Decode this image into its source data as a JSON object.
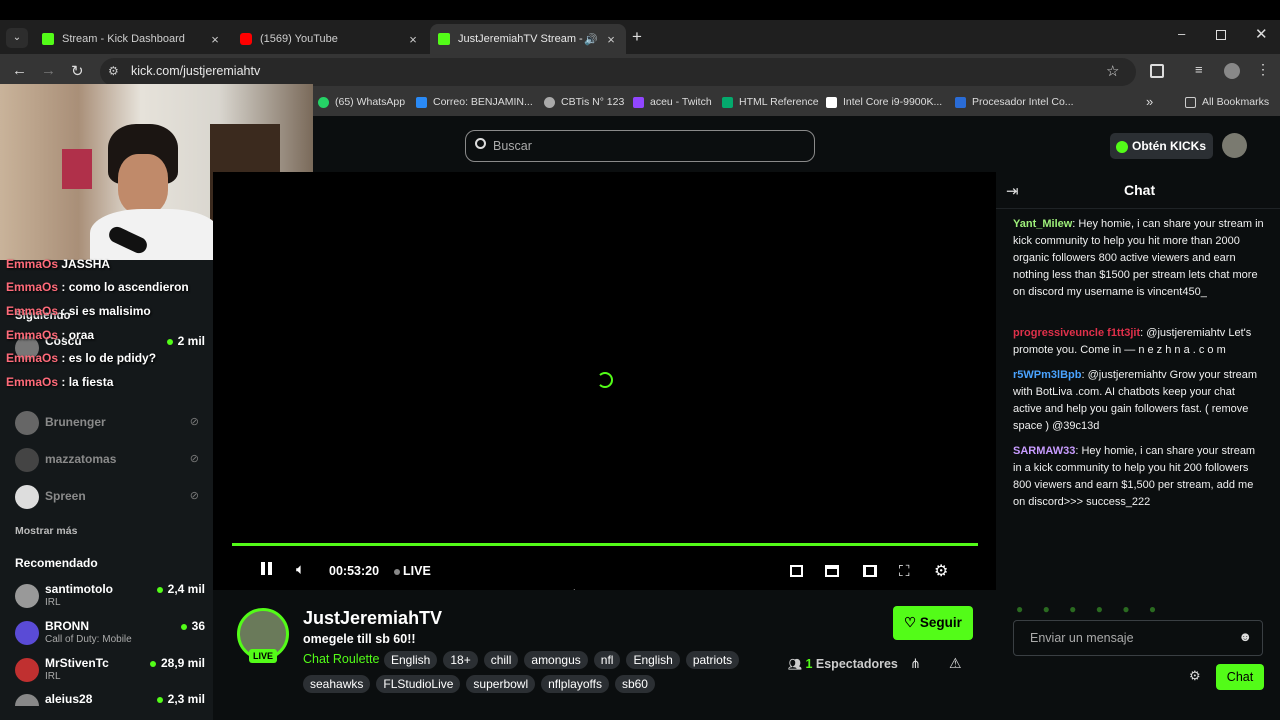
{
  "browser": {
    "tabs": [
      {
        "title": "Stream - Kick Dashboard",
        "icon": "kick-icon"
      },
      {
        "title": "(1569) YouTube",
        "icon": "youtube-icon"
      },
      {
        "title": "JustJeremiahTV Stream - W",
        "icon": "kick-icon"
      }
    ],
    "url": "kick.com/justjeremiahtv",
    "bookmarks": [
      "(65) WhatsApp",
      "Correo: BENJAMIN...",
      "CBTis N° 123",
      "aceu - Twitch",
      "HTML Reference",
      "Intel Core i9-9900K...",
      "Procesador Intel Co..."
    ],
    "all_bookmarks": "All Bookmarks",
    "overflow": "»"
  },
  "header": {
    "search_placeholder": "Buscar",
    "kicks_button": "Obtén KICKs"
  },
  "overlay_chat": [
    {
      "user": "EmmaOs",
      "text": " : como lo ascendieron"
    },
    {
      "user": "EmmaOs",
      "text": " : si es malisimo"
    },
    {
      "user": "EmmaOs",
      "text": " : oraa"
    },
    {
      "user": "EmmaOs",
      "text": " : es lo de pdidy?"
    },
    {
      "user": "EmmaOs",
      "text": " : la fiesta"
    }
  ],
  "overlay_top": {
    "user": "EmmaOs",
    "text": "JASSHA"
  },
  "sidebar": {
    "following_label": "Siguiendo",
    "following": [
      {
        "name": "Coscu",
        "count": "2 mil"
      },
      {
        "name": "Brunenger"
      },
      {
        "name": "mazzatomas"
      },
      {
        "name": "Spreen"
      }
    ],
    "show_more": "Mostrar más",
    "recommended_label": "Recomendado",
    "recommended": [
      {
        "name": "santimotolo",
        "sub": "IRL",
        "count": "2,4 mil"
      },
      {
        "name": "BRONN",
        "sub": "Call of Duty: Mobile",
        "count": "36"
      },
      {
        "name": "MrStivenTc",
        "sub": "IRL",
        "count": "28,9 mil"
      },
      {
        "name": "aleius28",
        "sub": "",
        "count": "2,3 mil"
      }
    ]
  },
  "player": {
    "time": "00:53:20",
    "live_label": "LIVE",
    "progress": 1.0
  },
  "stream": {
    "channel": "JustJeremiahTV",
    "title": "omegele till sb 60!!",
    "category": "Chat Roulette",
    "live_badge": "LIVE",
    "tags_row1": [
      "English",
      "18+",
      "chill",
      "amongus",
      "nfl",
      "English",
      "patriots"
    ],
    "tags_row2": [
      "seahawks",
      "FLStudioLive",
      "superbowl",
      "nflplayoffs",
      "sb60"
    ],
    "follow_button": "Seguir",
    "viewers_count": "1",
    "viewers_label": "Espectadores"
  },
  "chat": {
    "title": "Chat",
    "messages": [
      {
        "user": "Yant_Milew",
        "color": "#9ef07a",
        "text": "Hey homie, i can share your stream in kick community to help you hit more than 2000 organic followers 800 active viewers and earn nothing less than $1500 per stream lets chat more on discord my username is vincent450_"
      },
      {
        "user": "progressiveuncle f1tt3jit",
        "color": "#e0304a",
        "text": "@justjeremiahtv Let's promote you. Come in — n e z h n a . c o m"
      },
      {
        "user": "r5WPm3lBpb",
        "color": "#4aa3ff",
        "text": "@justjeremiahtv Grow your stream with BotLiva .com. AI chatbots keep your chat active and help you gain followers fast. ( remove space ) @39c13d"
      },
      {
        "user": "SARMAW33",
        "color": "#c89cff",
        "text": "Hey homie, i can share your stream in a kick community to help you hit 200 followers 800 viewers and earn $1,500 per stream, add me on discord>>> success_222"
      }
    ],
    "input_placeholder": "Enviar un mensaje",
    "send_button": "Chat"
  },
  "colors": {
    "accent": "#53fc18",
    "background": "#0b0e0f",
    "sidebar": "#14181a"
  }
}
